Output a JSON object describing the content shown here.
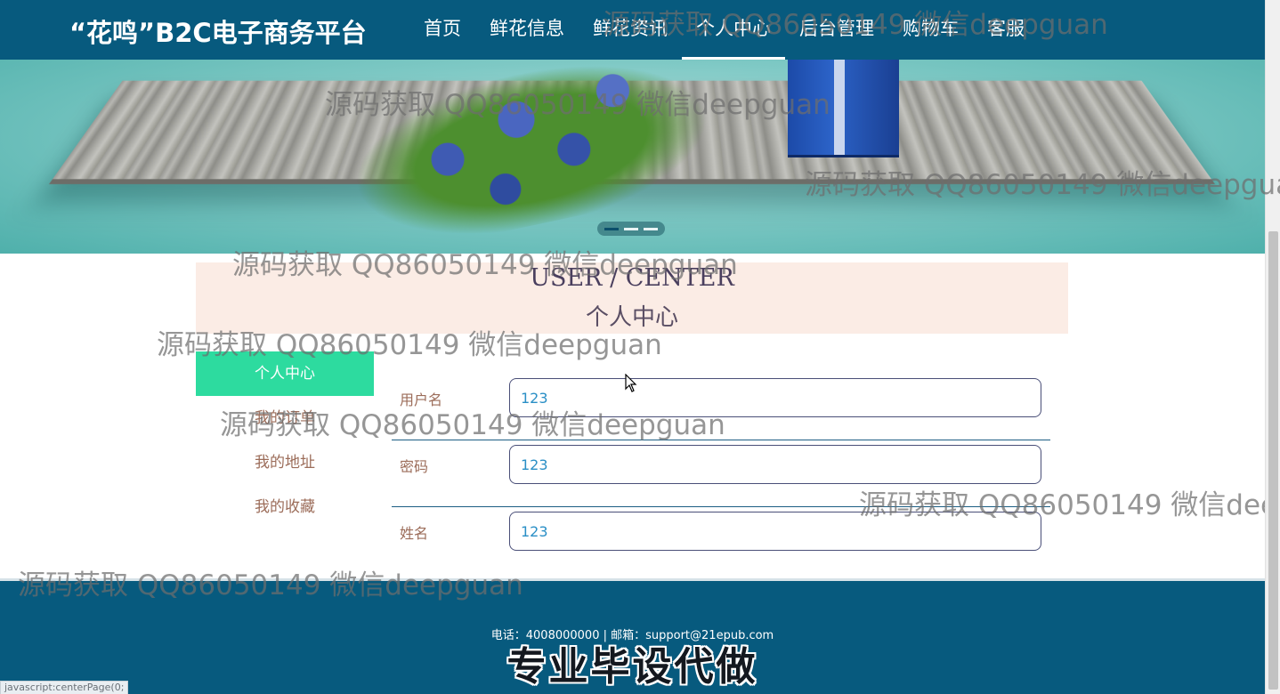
{
  "header": {
    "logo": "“花鸣”B2C电子商务平台",
    "nav": [
      "首页",
      "鲜花信息",
      "鲜花资讯",
      "个人中心",
      "后台管理",
      "购物车",
      "客服"
    ],
    "active_nav": "个人中心"
  },
  "banner": {
    "slides": 3,
    "active_slide": 1
  },
  "section": {
    "title_en": "USER / CENTER",
    "title_zh": "个人中心"
  },
  "sidebar": {
    "items": [
      "个人中心",
      "我的订单",
      "我的地址",
      "我的收藏"
    ],
    "active": "个人中心"
  },
  "form": {
    "fields": [
      {
        "label": "用户名",
        "value": "123"
      },
      {
        "label": "密码",
        "value": "123"
      },
      {
        "label": "姓名",
        "value": "123"
      }
    ]
  },
  "footer": {
    "contact": "电话：4008000000 | 邮箱：support@21epub.com",
    "slogan": "专业毕设代做"
  },
  "statusbar": {
    "text": "javascript:centerPage(0;"
  },
  "watermark": {
    "text": "源码获取 QQ86050149 微信deepguan"
  },
  "colors": {
    "header_bg": "#075a7e",
    "sidebar_active": "#2ddb9f",
    "title_bg": "#fbece5",
    "label_text": "#9c6d5a",
    "input_text": "#2a8fc6"
  }
}
